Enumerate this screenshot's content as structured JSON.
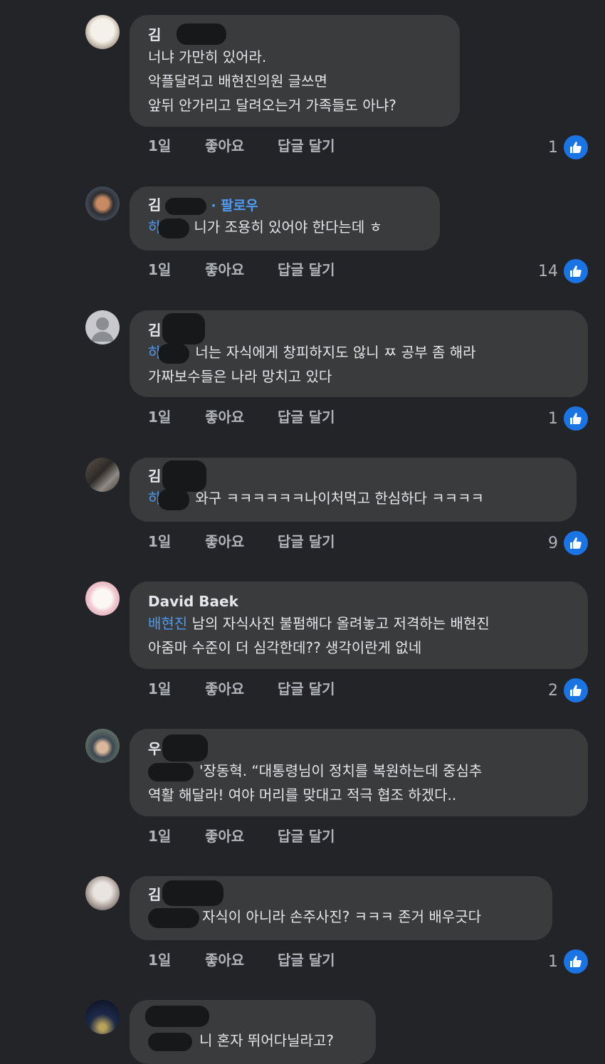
{
  "comments": [
    {
      "author": "김 ",
      "follow": "",
      "lines": [
        {
          "mention": "",
          "text": "너냐 가만히 있어라."
        },
        {
          "mention": "",
          "text": "악플달려고 배현진의원 글쓰면"
        },
        {
          "mention": "",
          "text": "앞뒤 안가리고 달려오는거 가족들도 아냐?"
        }
      ],
      "time": "1일",
      "like": "좋아요",
      "reply": "답글 달기",
      "likes": "1"
    },
    {
      "author": "김",
      "follow": "· 팔로우",
      "lines": [
        {
          "mention": "하",
          "text": "니가 조용히 있어야 한다는데 ㅎ"
        }
      ],
      "time": "1일",
      "like": "좋아요",
      "reply": "답글 달기",
      "likes": "14"
    },
    {
      "author": "김",
      "follow": "",
      "lines": [
        {
          "mention": "하",
          "text": "너는 자식에게 창피하지도 않니 ㅉ 공부 좀 해라"
        },
        {
          "mention": "",
          "text": "가짜보수들은 나라 망치고 있다"
        }
      ],
      "time": "1일",
      "like": "좋아요",
      "reply": "답글 달기",
      "likes": "1"
    },
    {
      "author": "김",
      "follow": "",
      "lines": [
        {
          "mention": "하",
          "text": "와구 ㅋㅋㅋㅋㅋㅋ나이처먹고 한심하다 ㅋㅋㅋㅋ"
        }
      ],
      "time": "1일",
      "like": "좋아요",
      "reply": "답글 달기",
      "likes": "9"
    },
    {
      "author": "David Baek",
      "follow": "",
      "lines": [
        {
          "mention": "배현진",
          "text": "남의 자식사진 불펌해다 올려놓고 저격하는 배현진"
        },
        {
          "mention": "",
          "text": "아줌마 수준이 더 심각한데?? 생각이란게 없네"
        }
      ],
      "time": "1일",
      "like": "좋아요",
      "reply": "답글 달기",
      "likes": "2"
    },
    {
      "author": "우",
      "follow": "",
      "lines": [
        {
          "mention": "",
          "text": "'장동혁. “대통령님이 정치를 복원하는데 중심추"
        },
        {
          "mention": "",
          "text": "역활 해달라! 여야 머리를 맞대고 적극 협조 하겠다.."
        }
      ],
      "time": "1일",
      "like": "좋아요",
      "reply": "답글 달기",
      "likes": ""
    },
    {
      "author": "김",
      "follow": "",
      "lines": [
        {
          "mention": "",
          "text": "자식이 아니라 손주사진? ㅋㅋㅋ 존거 배우긋다"
        }
      ],
      "time": "1일",
      "like": "좋아요",
      "reply": "답글 달기",
      "likes": "1"
    },
    {
      "author": "",
      "follow": "",
      "lines": [
        {
          "mention": "",
          "text": "니 혼자 뛰어다닐라고?"
        }
      ],
      "time": "",
      "like": "",
      "reply": "",
      "likes": ""
    }
  ],
  "colors": {
    "background": "#232428",
    "bubble": "#3a3b3c",
    "mention": "#4e9bf5",
    "like_badge": "#1b74e4"
  },
  "icons": {
    "like": "thumbs-up-icon",
    "avatar": "avatar-photo"
  }
}
